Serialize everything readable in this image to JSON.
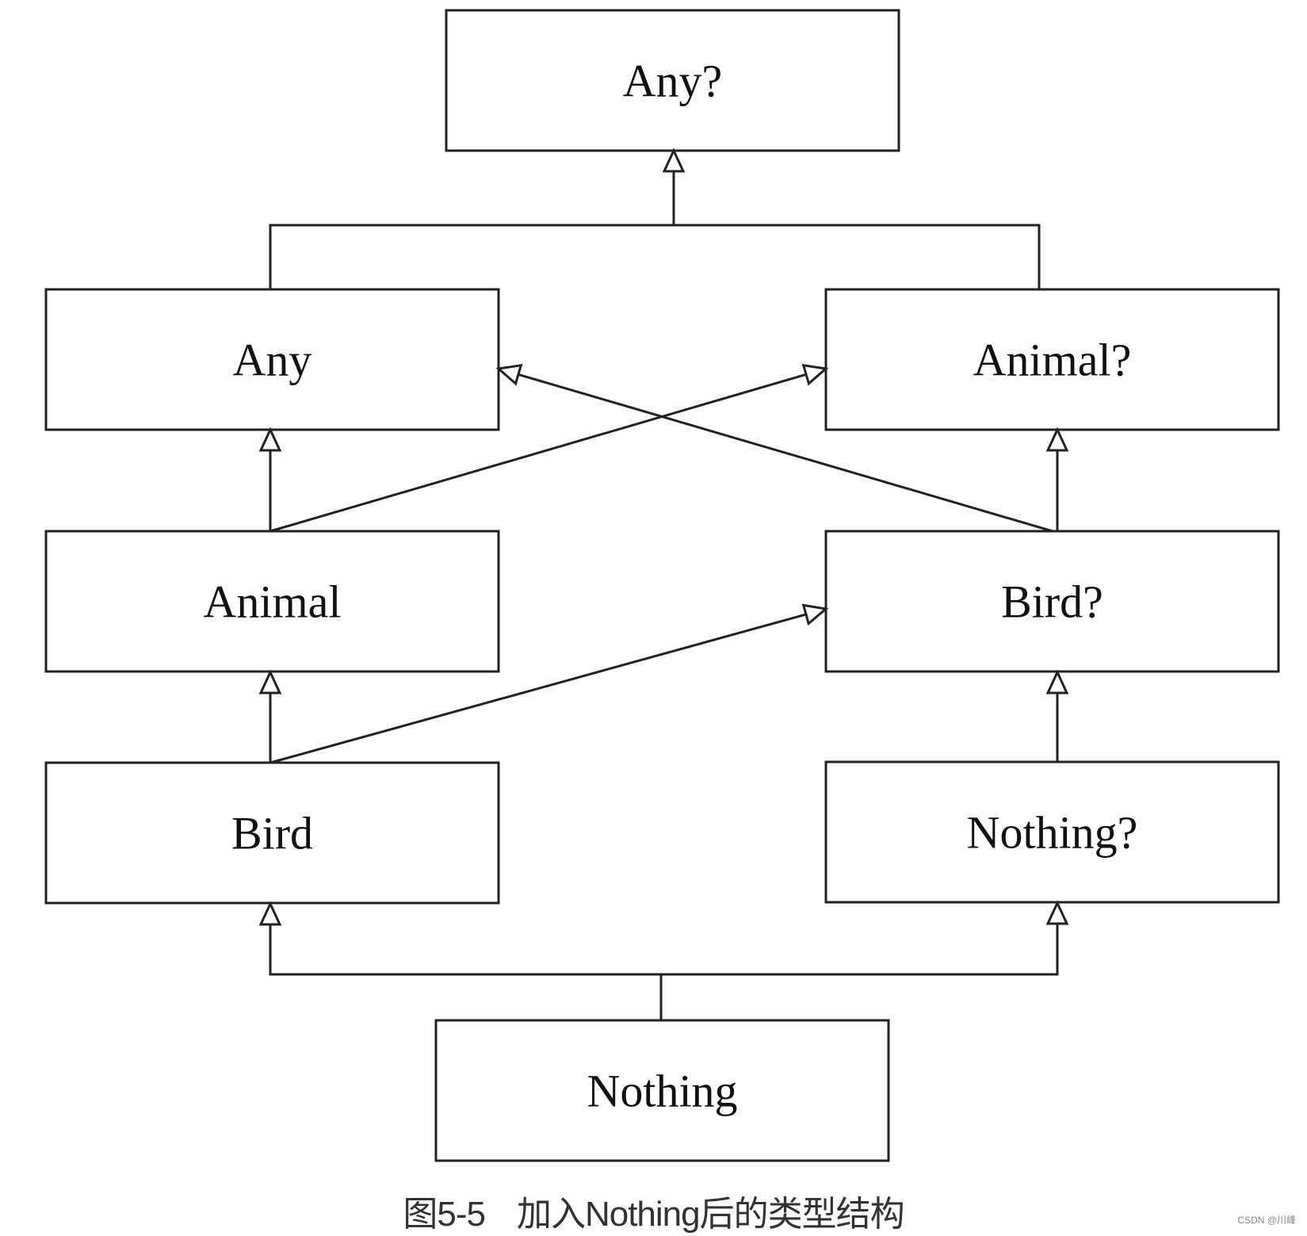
{
  "diagram": {
    "nodes": [
      {
        "id": "any_nullable",
        "label": "Any?"
      },
      {
        "id": "any",
        "label": "Any"
      },
      {
        "id": "animal_nullable",
        "label": "Animal?"
      },
      {
        "id": "animal",
        "label": "Animal"
      },
      {
        "id": "bird_nullable",
        "label": "Bird?"
      },
      {
        "id": "bird",
        "label": "Bird"
      },
      {
        "id": "nothing_nullable",
        "label": "Nothing?"
      },
      {
        "id": "nothing",
        "label": "Nothing"
      }
    ],
    "edges": [
      {
        "from": "any",
        "to": "any_nullable"
      },
      {
        "from": "animal_nullable",
        "to": "any_nullable"
      },
      {
        "from": "animal",
        "to": "any"
      },
      {
        "from": "animal",
        "to": "animal_nullable"
      },
      {
        "from": "bird_nullable",
        "to": "any"
      },
      {
        "from": "bird_nullable",
        "to": "animal_nullable"
      },
      {
        "from": "bird",
        "to": "animal"
      },
      {
        "from": "bird",
        "to": "bird_nullable"
      },
      {
        "from": "nothing_nullable",
        "to": "bird_nullable"
      },
      {
        "from": "nothing",
        "to": "bird"
      },
      {
        "from": "nothing",
        "to": "nothing_nullable"
      }
    ],
    "edge_style": "hollow-triangle-arrow",
    "line_color": "#222222"
  },
  "caption": {
    "figure_number": "图5-5",
    "text": "加入Nothing后的类型结构"
  },
  "watermark": "CSDN @川峰"
}
